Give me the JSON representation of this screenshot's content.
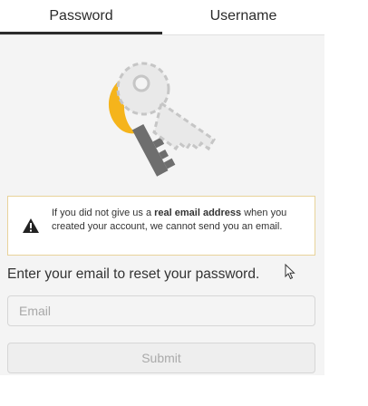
{
  "tabs": [
    {
      "label": "Password",
      "active": true
    },
    {
      "label": "Username",
      "active": false
    }
  ],
  "illustration": {
    "icon": "key-icon",
    "colors": {
      "gold": "#f5b41b",
      "dashed_outline": "#c8c8c8",
      "key_shaft": "#6e6e6e"
    }
  },
  "notice": {
    "icon": "warning-icon",
    "text_before": "If you did not give us a ",
    "text_bold": "real email address",
    "text_after": " when you created your account, we cannot send you an email."
  },
  "form": {
    "prompt": "Enter your email to reset your password.",
    "email_placeholder": "Email",
    "email_value": "",
    "submit_label": "Submit"
  },
  "colors": {
    "panel_bg": "#f4f4f4",
    "notice_border": "#e8d39a",
    "active_tab_underline": "#2b2b2b"
  }
}
